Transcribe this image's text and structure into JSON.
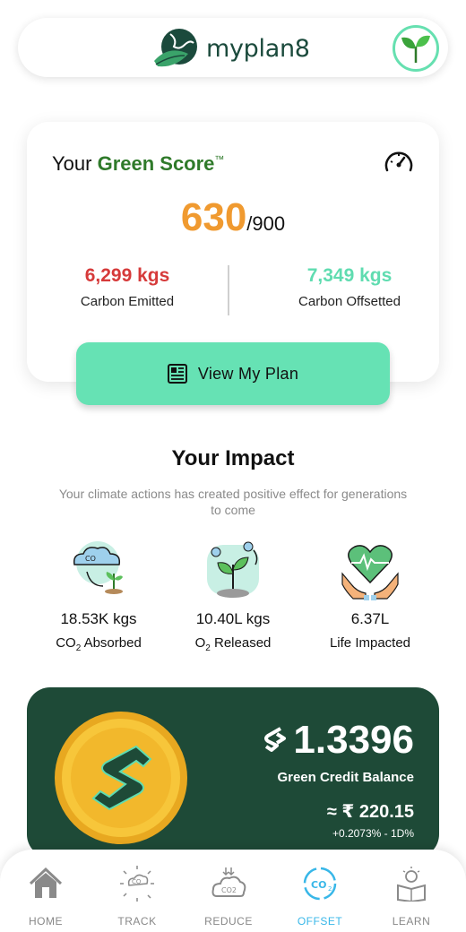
{
  "header": {
    "app_name": "myplan8"
  },
  "score_card": {
    "title_prefix": "Your ",
    "title_green": "Green Score",
    "title_tm": "™",
    "score": "630",
    "score_max": "/900",
    "carbon_emitted_value": "6,299 kgs",
    "carbon_emitted_label": "Carbon Emitted",
    "carbon_offsetted_value": "7,349 kgs",
    "carbon_offsetted_label": "Carbon Offsetted",
    "view_plan_label": "View My Plan"
  },
  "impact": {
    "title": "Your Impact",
    "subtitle": "Your climate actions has created positive effect for generations to come",
    "items": [
      {
        "value": "18.53K kgs",
        "label_main": "CO",
        "label_sub": "2",
        "label_rest": " Absorbed"
      },
      {
        "value": "10.40L kgs",
        "label_main": "O",
        "label_sub": "2",
        "label_rest": " Released"
      },
      {
        "value": "6.37L",
        "label_main": "Life Impacted",
        "label_sub": "",
        "label_rest": ""
      }
    ]
  },
  "credit": {
    "balance": "1.3396",
    "label": "Green Credit Balance",
    "rupee_value": "≈ ₹ 220.15",
    "change": "+0.2073% - 1D%"
  },
  "nav": {
    "items": [
      {
        "label": "HOME",
        "icon": "home-icon"
      },
      {
        "label": "TRACK",
        "icon": "track-icon"
      },
      {
        "label": "REDUCE",
        "icon": "reduce-icon"
      },
      {
        "label": "OFFSET",
        "icon": "offset-icon",
        "active": true
      },
      {
        "label": "LEARN",
        "icon": "learn-icon"
      }
    ]
  },
  "colors": {
    "accent_green": "#66e2b4",
    "score_orange": "#f09a30",
    "emitted_red": "#d63a3a",
    "offset_teal": "#5fdcb0",
    "card_dark_green": "#1e4a37",
    "nav_active": "#38b7e8"
  }
}
